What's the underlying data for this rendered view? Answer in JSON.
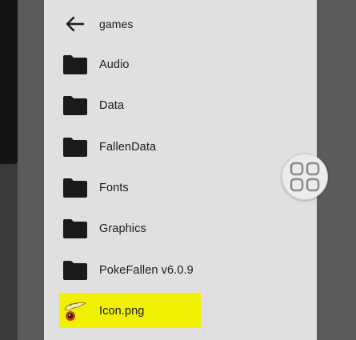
{
  "header": {
    "back_label": "games"
  },
  "file_list": {
    "items": [
      {
        "name": "Audio",
        "type": "folder"
      },
      {
        "name": "Data",
        "type": "folder"
      },
      {
        "name": "FallenData",
        "type": "folder"
      },
      {
        "name": "Fonts",
        "type": "folder"
      },
      {
        "name": "Graphics",
        "type": "folder"
      },
      {
        "name": "PokeFallen v6.0.9",
        "type": "folder"
      },
      {
        "name": "Icon.png",
        "type": "image",
        "highlighted": true
      }
    ]
  },
  "colors": {
    "dialog_bg": "#e0e0e2",
    "backdrop": "#5b5b5b",
    "highlight": "#f0f000",
    "folder_icon": "#1a1a1a"
  },
  "floating_button": {
    "icon": "grid-menu-icon"
  }
}
